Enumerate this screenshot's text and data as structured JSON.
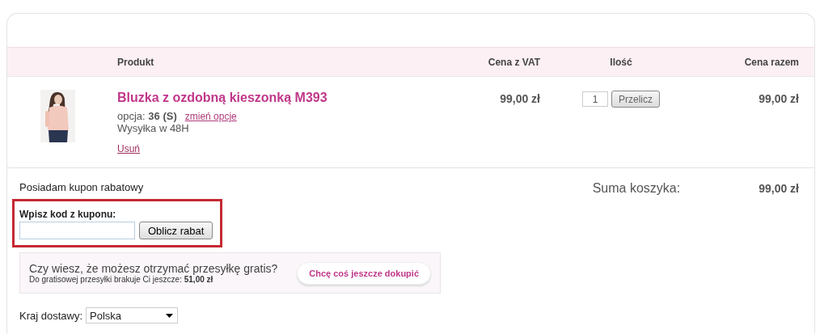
{
  "table": {
    "columns": [
      {
        "label": "Produkt"
      },
      {
        "label": "Cena z VAT"
      },
      {
        "label": "Ilość"
      },
      {
        "label": "Cena razem"
      }
    ],
    "rows": [
      {
        "name": "Bluzka z ozdobną kieszonką M393",
        "option_label": "opcja:",
        "option_value": "36 (S)",
        "change_link": "zmień opcje",
        "shipping": "Wysyłka w 48H",
        "remove_link": "Usuń",
        "price": "99,00 zł",
        "quantity": "1",
        "recalc_button": "Przelicz",
        "total": "99,00 zł"
      }
    ]
  },
  "coupon": {
    "toggle": "Posiadam kupon rabatowy",
    "label": "Wpisz kod z kuponu:",
    "button": "Oblicz rabat"
  },
  "free_shipping": {
    "question": "Czy wiesz, że możesz otrzymać przesyłkę gratis?",
    "detail": "Do gratisowej przesyłki brakuje Ci jeszcze: **51,00 zł**",
    "button": "Chcę coś jeszcze dokupić"
  },
  "country": {
    "label": "Kraj dostawy:",
    "value": "Polska"
  },
  "summary": {
    "label": "Suma koszyka:",
    "value": "99,00 zł"
  }
}
